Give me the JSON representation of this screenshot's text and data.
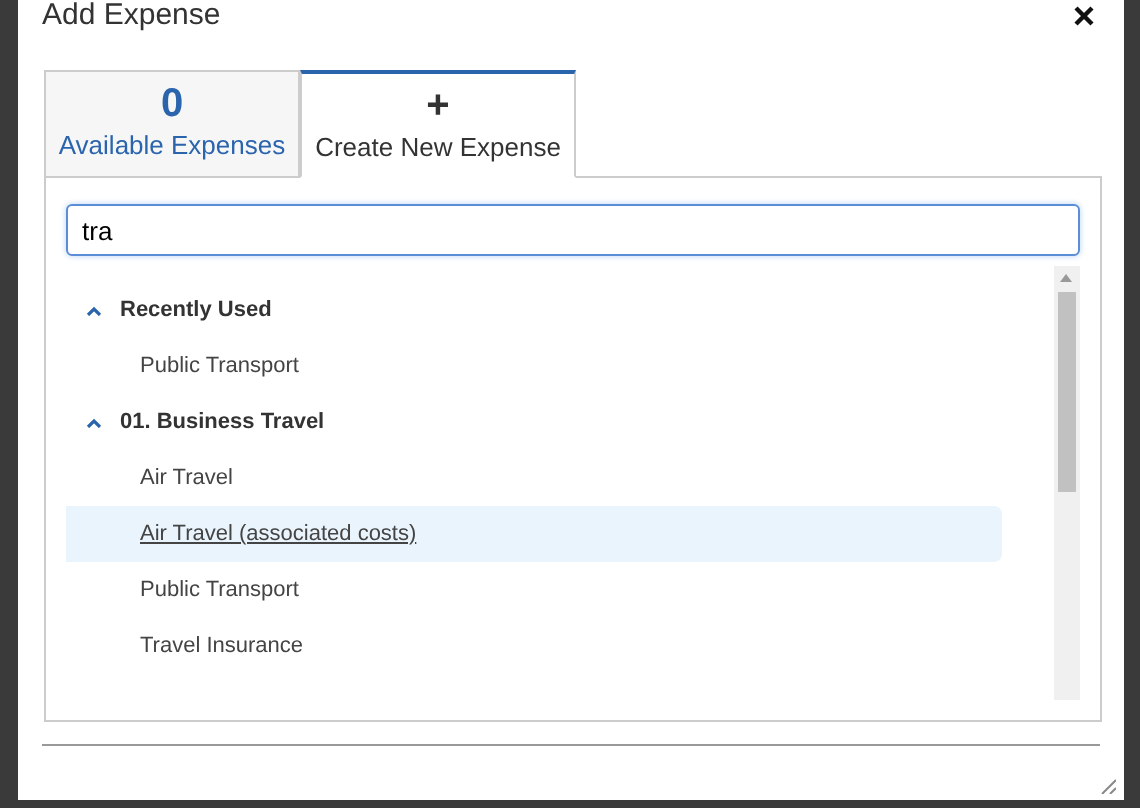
{
  "window": {
    "title": "Add Expense"
  },
  "tabs": [
    {
      "count": "0",
      "label": "Available Expenses",
      "selected": false
    },
    {
      "count": "+",
      "label": "Create New Expense",
      "selected": true
    }
  ],
  "search": {
    "value": "tra"
  },
  "groups": [
    {
      "title": "Recently Used",
      "expanded": true,
      "items": [
        {
          "label": "Public Transport",
          "selected": false
        }
      ]
    },
    {
      "title": "01. Business Travel",
      "expanded": true,
      "items": [
        {
          "label": "Air Travel",
          "selected": false
        },
        {
          "label": "Air Travel (associated costs)",
          "selected": true
        },
        {
          "label": "Public Transport",
          "selected": false
        },
        {
          "label": "Travel Insurance",
          "selected": false
        }
      ]
    }
  ]
}
